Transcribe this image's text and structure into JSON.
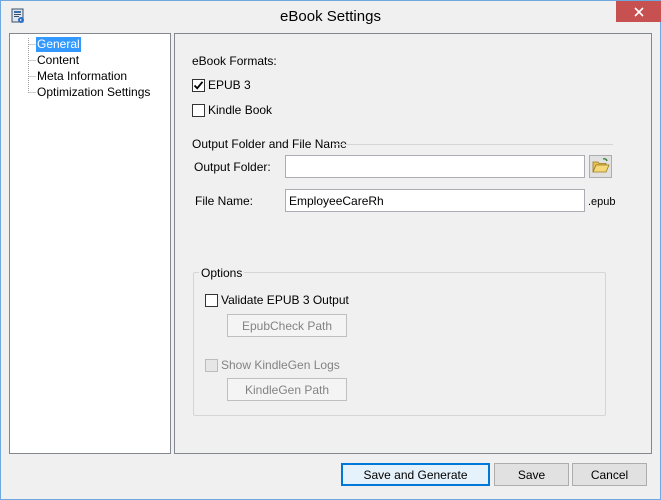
{
  "window": {
    "title": "eBook Settings"
  },
  "tree": {
    "items": [
      {
        "label": "General",
        "selected": true
      },
      {
        "label": "Content",
        "selected": false
      },
      {
        "label": "Meta Information",
        "selected": false
      },
      {
        "label": "Optimization Settings",
        "selected": false
      }
    ]
  },
  "general": {
    "formats_heading": "eBook Formats:",
    "epub_label": "EPUB 3",
    "epub_checked": true,
    "kindle_label": "Kindle Book",
    "kindle_checked": false,
    "output_section_title": "Output Folder and File Name",
    "output_folder_label": "Output Folder:",
    "output_folder_value": "",
    "file_name_label": "File Name:",
    "file_name_value": "EmployeeCareRh",
    "file_ext": ".epub"
  },
  "options": {
    "title": "Options",
    "validate_label": "Validate EPUB 3 Output",
    "validate_checked": false,
    "epubcheck_button": "EpubCheck Path",
    "kindlegen_logs_label": "Show KindleGen Logs",
    "kindlegen_logs_checked": false,
    "kindlegen_button": "KindleGen Path"
  },
  "footer": {
    "save_generate": "Save and Generate",
    "save": "Save",
    "cancel": "Cancel"
  },
  "colors": {
    "selection": "#3399ff",
    "close": "#c75050"
  },
  "icons": {
    "app": "app-icon",
    "close": "close-icon",
    "folder": "open-folder-icon",
    "check": "check-icon"
  }
}
